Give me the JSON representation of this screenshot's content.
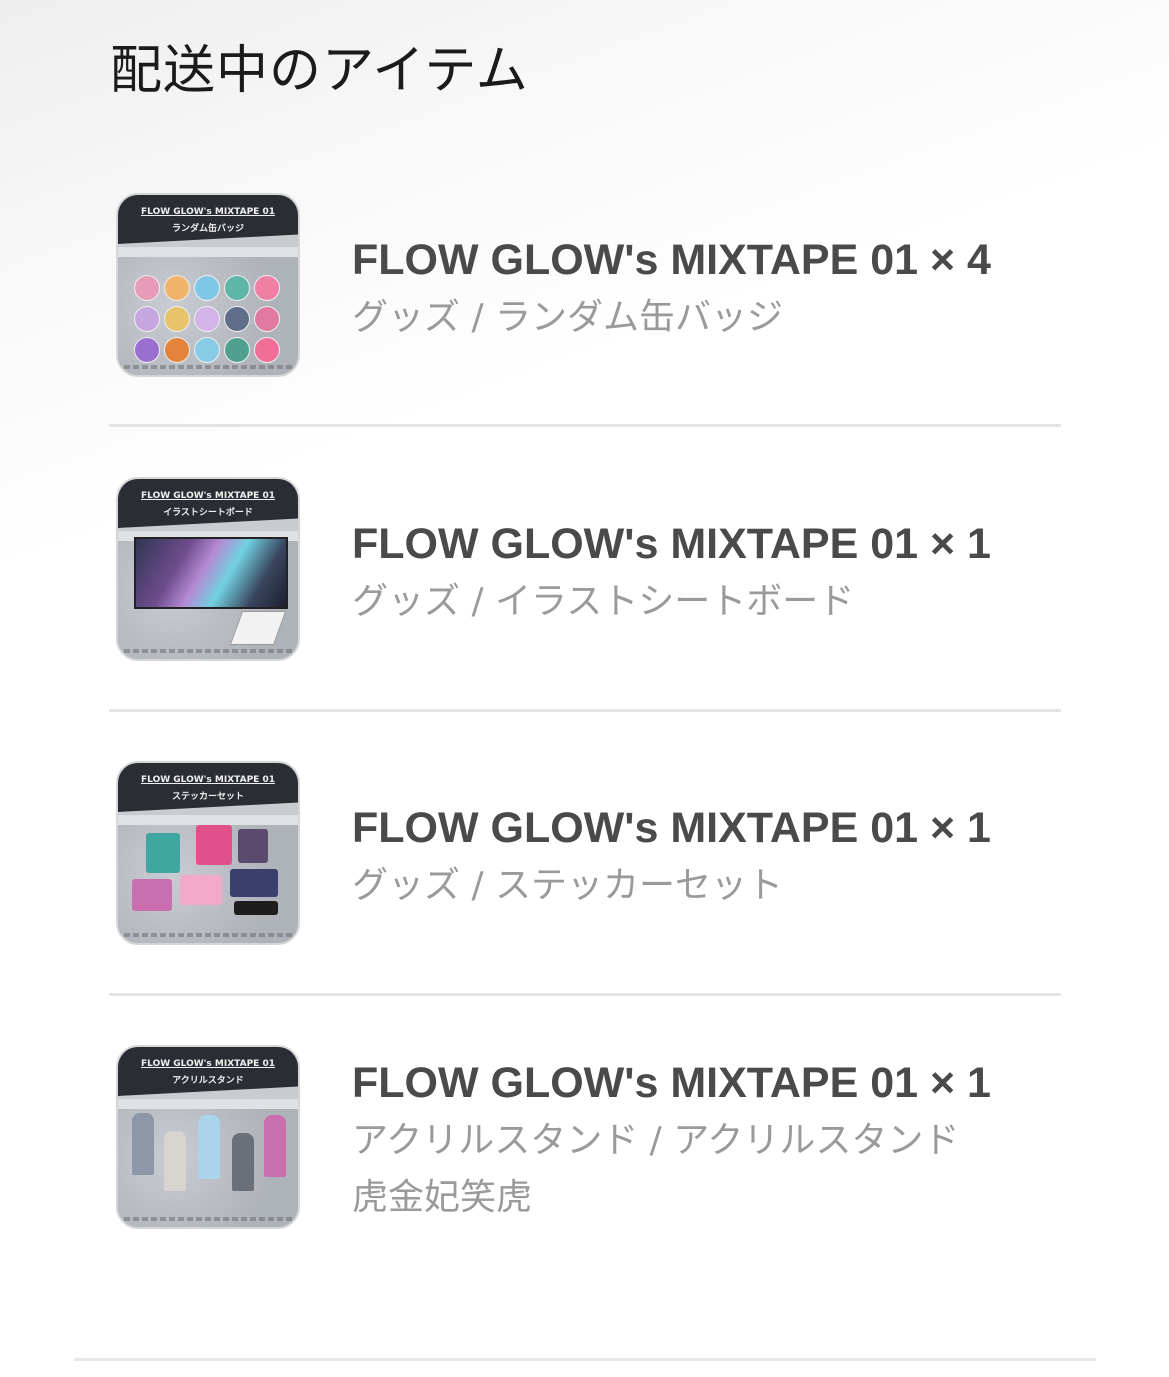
{
  "section": {
    "title": "配送中のアイテム"
  },
  "items": [
    {
      "title": "FLOW GLOW's MIXTAPE 01 × 4",
      "subtitle": "グッズ / ランダム缶バッジ",
      "thumb_line1": "FLOW GLOW's MIXTAPE 01",
      "thumb_line2": "ランダム缶バッジ"
    },
    {
      "title": "FLOW GLOW's MIXTAPE 01 × 1",
      "subtitle": "グッズ / イラストシートボード",
      "thumb_line1": "FLOW GLOW's MIXTAPE 01",
      "thumb_line2": "イラストシートボード"
    },
    {
      "title": "FLOW GLOW's MIXTAPE 01 × 1",
      "subtitle": "グッズ / ステッカーセット",
      "thumb_line1": "FLOW GLOW's MIXTAPE 01",
      "thumb_line2": "ステッカーセット"
    },
    {
      "title": "FLOW GLOW's MIXTAPE 01 × 1",
      "subtitle": "アクリルスタンド / アクリルスタンド",
      "subtitle2": "虎金妃笑虎",
      "thumb_line1": "FLOW GLOW's MIXTAPE 01",
      "thumb_line2": "アクリルスタンド"
    }
  ],
  "colors": {
    "title_text": "#4a4a4a",
    "subtitle_text": "#9a9a9a",
    "divider": "#e4e4e4"
  }
}
